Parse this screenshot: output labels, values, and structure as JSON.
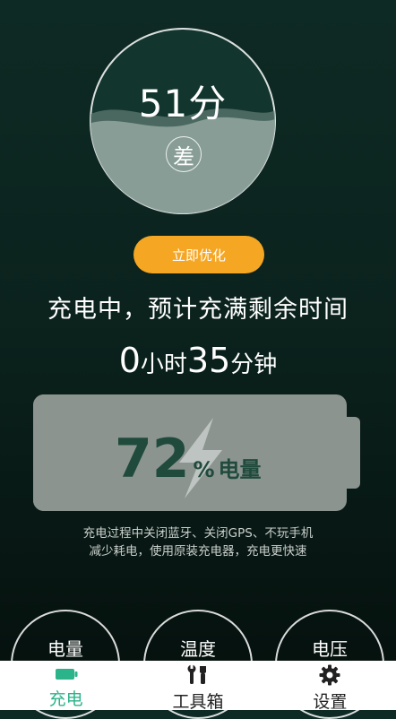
{
  "score": {
    "value": "51分",
    "grade": "差"
  },
  "optimize_button": "立即优化",
  "status": "充电中，预计充满剩余时间",
  "remaining": {
    "hours": "0",
    "hours_unit": "小时",
    "minutes": "35",
    "minutes_unit": "分钟"
  },
  "battery": {
    "percent": "72",
    "percent_symbol": "%",
    "label": "电量",
    "level": 72
  },
  "tip": {
    "line1": "充电过程中关闭蓝牙、关闭GPS、不玩手机",
    "line2": "减少耗电，使用原装充电器，充电更快速"
  },
  "metrics": [
    "电量",
    "温度",
    "电压"
  ],
  "tabs": [
    {
      "label": "充电",
      "icon": "battery-icon",
      "active": true
    },
    {
      "label": "工具箱",
      "icon": "tools-icon",
      "active": false
    },
    {
      "label": "设置",
      "icon": "gear-icon",
      "active": false
    }
  ],
  "colors": {
    "accent": "#2bb38a",
    "button": "#f5a623",
    "battery": "#8c9490",
    "battery_text": "#1f4a3c"
  }
}
